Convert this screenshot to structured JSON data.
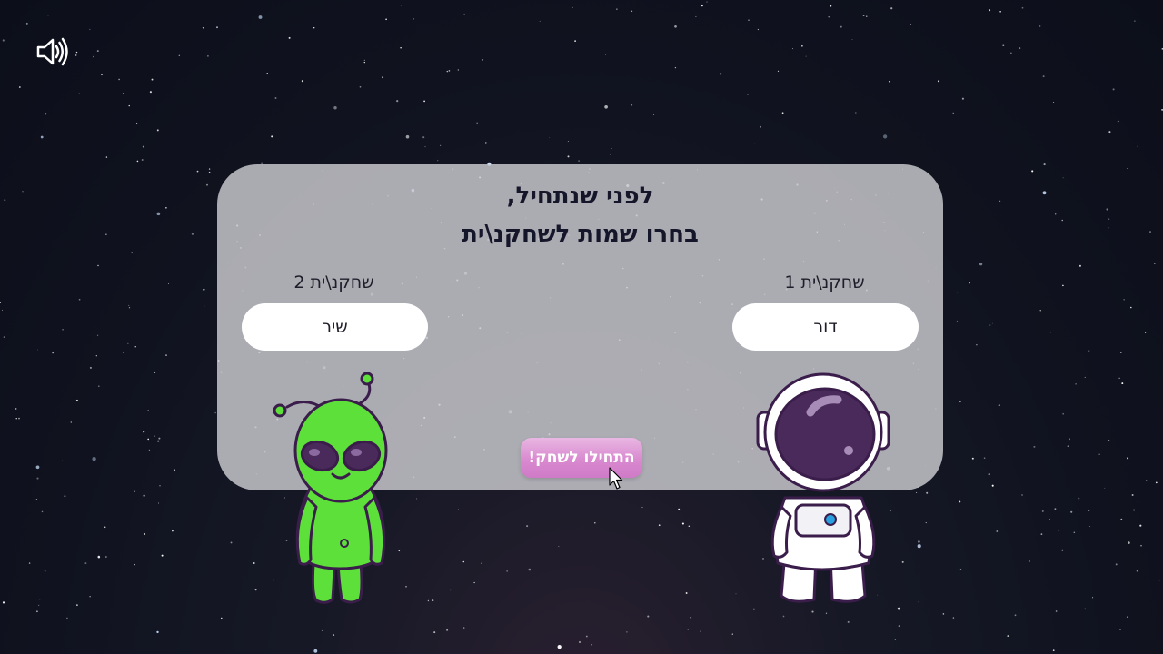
{
  "title": {
    "line1": "לפני שנתחיל,",
    "line2": "בחרו שמות לשחקנ\\ית"
  },
  "players": [
    {
      "label": "שחקנ\\ית 1",
      "value": "דור",
      "character": "astronaut-character"
    },
    {
      "label": "שחקנ\\ית 2",
      "value": "שיר",
      "character": "alien-character"
    }
  ],
  "start_button": {
    "label": "התחילו לשחק!"
  },
  "sound_toggle": {
    "icon": "speaker-icon",
    "state": "on"
  },
  "colors": {
    "panel": "#cdcdd2",
    "start_button": "#d98ad0",
    "alien": "#5ee03a",
    "astronaut_visor": "#4a2a5a"
  }
}
